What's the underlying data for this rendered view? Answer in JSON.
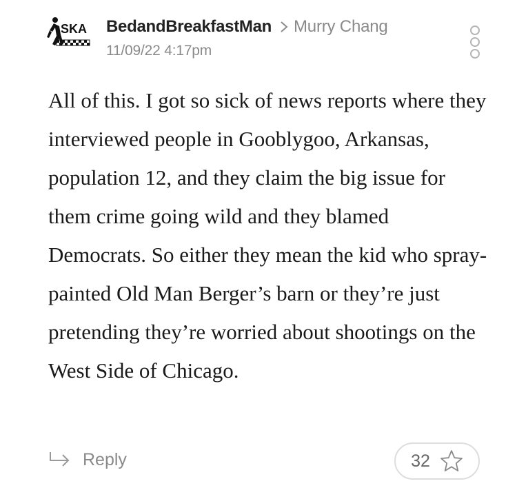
{
  "comment": {
    "avatar": {
      "logo_text": "SKA",
      "icon": "ska-logo-avatar"
    },
    "author": "BedandBreakfastMan",
    "reply_to_icon": "chevron-right-icon",
    "in_reply_to": "Murry Chang",
    "timestamp": "11/09/22 4:17pm",
    "more_icon": "vertical-dots-icon",
    "body": "All of this. I got so sick of news reports where they interviewed people in Gooblygoo, Arkansas, population 12, and they claim the big issue for them crime going wild and they blamed Democrats. So either they mean the kid who spray-painted Old Man Berger’s barn or they’re just pretending they’re worried about shootings on the West Side of Chicago."
  },
  "actions": {
    "reply_icon": "reply-arrow-icon",
    "reply_label": "Reply",
    "star_count": "32",
    "star_icon": "star-outline-icon"
  },
  "colors": {
    "author": "#222222",
    "muted": "#8a8a8a",
    "body": "#1a1a1a",
    "pill_border": "#dddddd"
  }
}
